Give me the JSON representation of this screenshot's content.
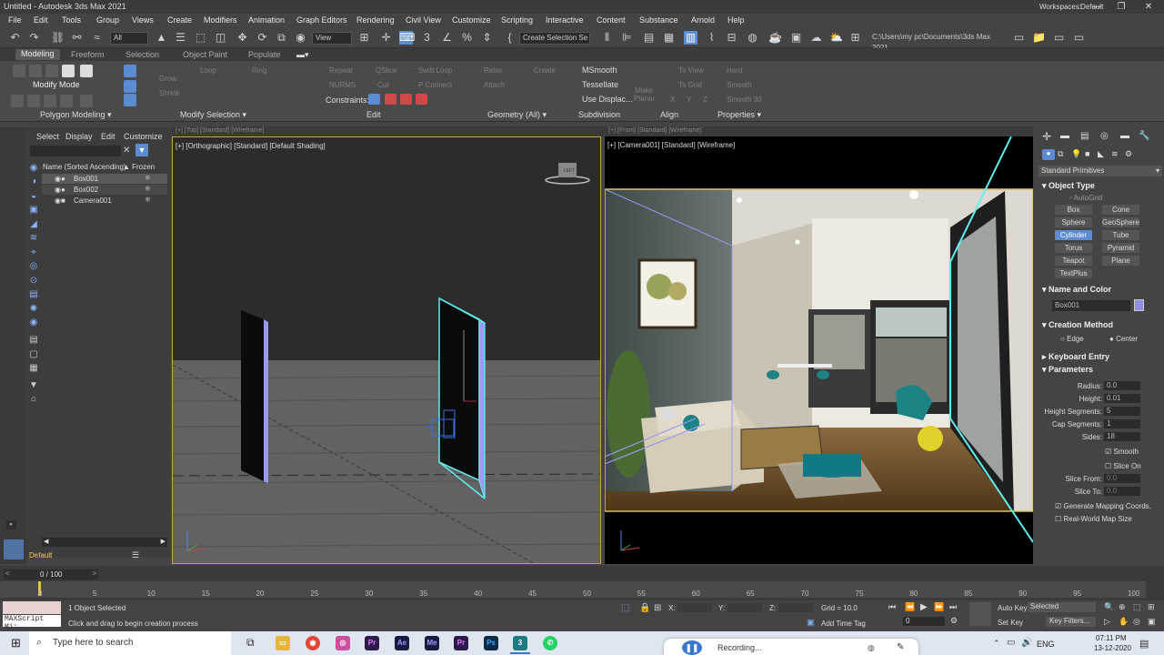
{
  "window": {
    "title": "Untitled - Autodesk 3ds Max 2021",
    "workspaces_label": "Workspaces:",
    "workspaces_value": "Default"
  },
  "menu": [
    "File",
    "Edit",
    "Tools",
    "Group",
    "Views",
    "Create",
    "Modifiers",
    "Animation",
    "Graph Editors",
    "Rendering",
    "Civil View",
    "Customize",
    "Scripting",
    "Interactive",
    "Content",
    "Substance",
    "Arnold",
    "Help"
  ],
  "toolbar": {
    "filter": "All",
    "refcoord": "View",
    "selset": "Create Selection Se",
    "path": "C:\\Users\\my pc\\Documents\\3ds Max 2021"
  },
  "ribbon_tabs": [
    "Modeling",
    "Freeform",
    "Selection",
    "Object Paint",
    "Populate"
  ],
  "ribbon": {
    "modify_mode": "Modify Mode",
    "panels": [
      "Polygon Modeling ▾",
      "Modify Selection ▾",
      "Edit",
      "Geometry (All) ▾",
      "Subdivision",
      "Align",
      "Properties ▾"
    ],
    "grow": "Grow",
    "shrink": "Shrink",
    "loop": "Loop",
    "ring": "Ring",
    "repeat": "Repeat",
    "qslice": "QSlice",
    "swiftloop": "Swift Loop",
    "nurms": "NURMS",
    "cut": "Cut",
    "pconnect": "P Connect",
    "constraints": "Constraints:",
    "relax": "Relax",
    "create": "Create",
    "attach": "Attach",
    "msmooth": "MSmooth",
    "tessellate": "Tessellate",
    "usedisplace": "Use Displac...",
    "makeplanar": "Make Planar",
    "toview": "To View",
    "togrid": "To Grid",
    "xyz": [
      "X",
      "Y",
      "Z"
    ],
    "hard": "Hard",
    "smooth": "Smooth",
    "smooth30": "Smooth 30"
  },
  "explorer": {
    "menus": [
      "Select",
      "Display",
      "Edit",
      "Customize"
    ],
    "col_name": "Name (Sorted Ascending)",
    "col_frozen": "▲ Frozen",
    "items": [
      "Box001",
      "Box002",
      "Camera001"
    ],
    "layer": "Default"
  },
  "viewports": {
    "left_label": "[+] [Orthographic] [Standard] [Default Shading]",
    "right_label": "[+] [Camera001] [Standard] [Wireframe]",
    "top_hidden_left": "[+] [Top] [Standard] [Wireframe]",
    "top_hidden_right": "[+] [Front] [Standard] [Wireframe]",
    "viewcube": "LEFT"
  },
  "command": {
    "dropdown": "Standard Primitives",
    "object_type": "Object Type",
    "autogrid": "AutoGrid",
    "buttons": [
      "Box",
      "Cone",
      "Sphere",
      "GeoSphere",
      "Cylinder",
      "Tube",
      "Torus",
      "Pyramid",
      "Teapot",
      "Plane",
      "TextPlus"
    ],
    "name_color": "Name and Color",
    "object_name": "Box001",
    "swatch": "#8f8fe6",
    "creation_method": "Creation Method",
    "edge": "Edge",
    "center": "Center",
    "keyboard_entry": "Keyboard Entry",
    "parameters": "Parameters",
    "params": [
      {
        "label": "Radius:",
        "value": "0.0"
      },
      {
        "label": "Height:",
        "value": "0.01"
      },
      {
        "label": "Height Segments:",
        "value": "5"
      },
      {
        "label": "Cap Segments:",
        "value": "1"
      },
      {
        "label": "Sides:",
        "value": "18"
      }
    ],
    "smooth": "Smooth",
    "slice_on": "Slice On",
    "slice_from": "Slice From:",
    "slice_from_v": "0.0",
    "slice_to": "Slice To:",
    "slice_to_v": "0.0",
    "gen_map": "Generate Mapping Coords.",
    "real_world": "Real-World Map Size"
  },
  "timeline": {
    "frame": "0 / 100",
    "ticks": [
      "0",
      "5",
      "10",
      "15",
      "20",
      "25",
      "30",
      "35",
      "40",
      "45",
      "50",
      "55",
      "60",
      "65",
      "70",
      "75",
      "80",
      "85",
      "90",
      "95",
      "100"
    ]
  },
  "status": {
    "selected": "1 Object Selected",
    "prompt": "Click and drag to begin creation process",
    "script": "MAXScript Mi:",
    "x": "X:",
    "y": "Y:",
    "z": "Z:",
    "grid": "Grid = 10.0",
    "addtime": "Add Time Tag",
    "autokey": "Auto Key",
    "setkey": "Set Key",
    "selected_dd": "Selected",
    "keyfilters": "Key Filters...",
    "frame_field": "0"
  },
  "taskbar": {
    "search": "Type here to search",
    "recording": "Recording...",
    "lang": "ENG",
    "time": "07:11 PM",
    "date": "13-12-2020"
  }
}
